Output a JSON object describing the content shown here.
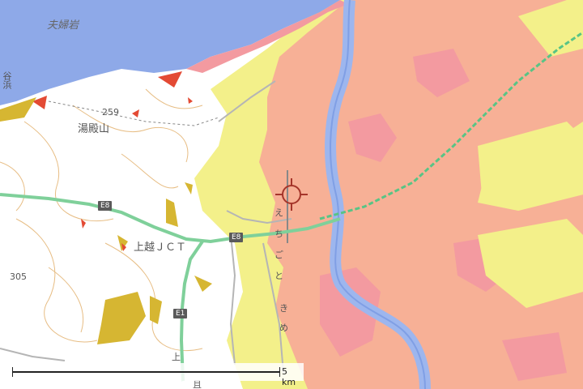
{
  "labels": {
    "coast": "夫婦岩",
    "mountain": "湯殿山",
    "elevation_1": "259",
    "elevation_2": "305",
    "junction": "上越ＪＣＴ",
    "shield_1": "E8",
    "shield_2": "E8",
    "shield_3": "E1",
    "rail_chars": [
      "え",
      "ち",
      "ご",
      "と",
      "き",
      "め"
    ],
    "road_char_1": "上",
    "road_char_2": "且",
    "left_edge": "谷浜"
  },
  "scale": {
    "text": "5 km"
  },
  "colors": {
    "sea": "#8ea9e8",
    "river": "#9db6ee",
    "flood_light": "#f3f08a",
    "flood_salmon": "#f7b096",
    "flood_pink": "#f39aa0",
    "flood_red": "#e34a34",
    "landslide": "#d6b632",
    "expressway": "#7fd09a",
    "contour": "#e7bd84"
  }
}
